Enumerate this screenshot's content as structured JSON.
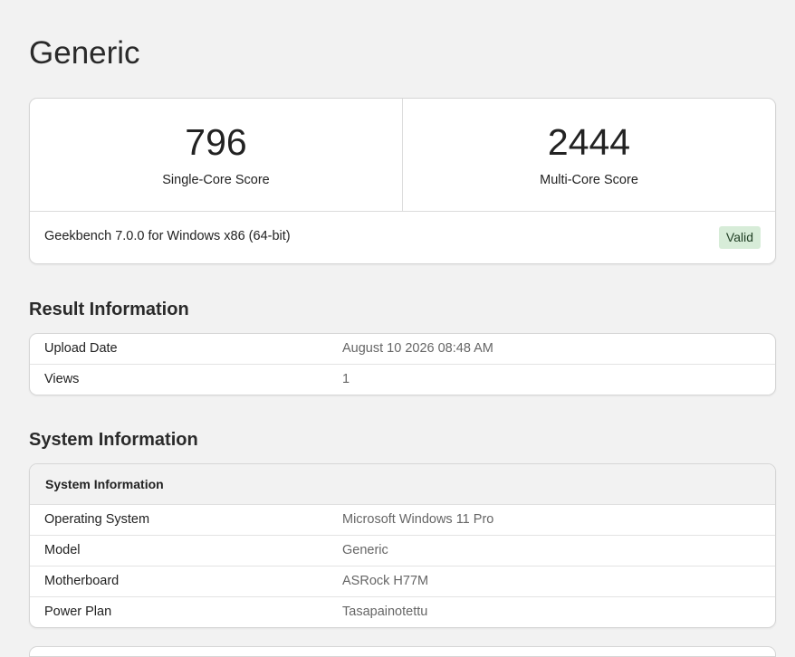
{
  "page": {
    "title": "Generic"
  },
  "scores": {
    "single_core": {
      "value": "796",
      "label": "Single-Core Score"
    },
    "multi_core": {
      "value": "2444",
      "label": "Multi-Core Score"
    },
    "version": "Geekbench 7.0.0 for Windows x86 (64-bit)",
    "status": "Valid"
  },
  "result_information": {
    "heading": "Result Information",
    "rows": [
      {
        "key": "Upload Date",
        "value": "August 10 2026 08:48 AM"
      },
      {
        "key": "Views",
        "value": "1"
      }
    ]
  },
  "system_information": {
    "heading": "System Information",
    "table_heading": "System Information",
    "rows": [
      {
        "key": "Operating System",
        "value": "Microsoft Windows 11 Pro"
      },
      {
        "key": "Model",
        "value": "Generic"
      },
      {
        "key": "Motherboard",
        "value": "ASRock H77M"
      },
      {
        "key": "Power Plan",
        "value": "Tasapainotettu"
      }
    ]
  },
  "colors": {
    "background": "#f2f2f2",
    "card": "#ffffff",
    "valid_badge_bg": "#d7ecd8",
    "valid_badge_text": "#1e3d22",
    "value_text": "#666666"
  }
}
